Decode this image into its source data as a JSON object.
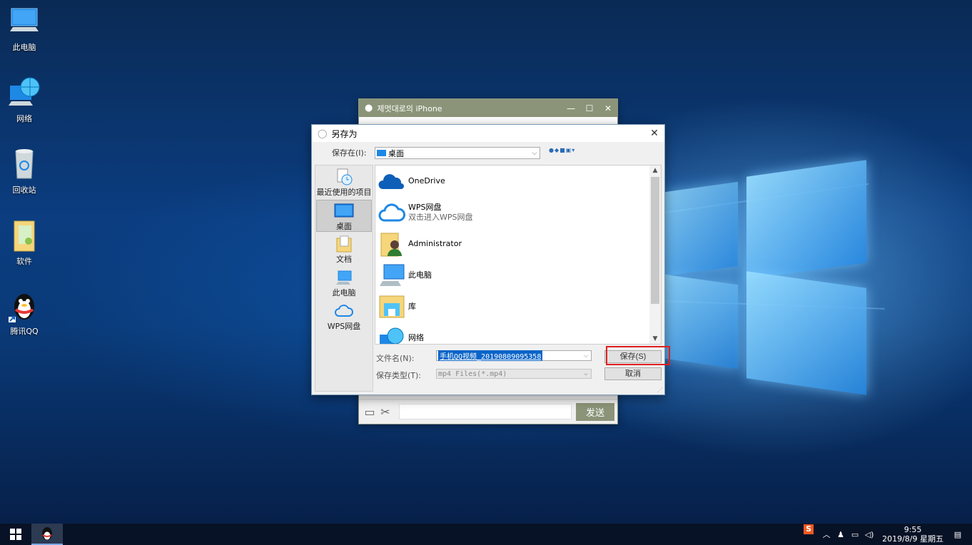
{
  "desktop": {
    "icons": [
      {
        "label": "此电脑",
        "icon": "computer-icon"
      },
      {
        "label": "网络",
        "icon": "network-globe-icon"
      },
      {
        "label": "回收站",
        "icon": "recycle-bin-icon"
      },
      {
        "label": "软件",
        "icon": "folder-icon"
      },
      {
        "label": "腾讯QQ",
        "icon": "qq-penguin-icon"
      }
    ]
  },
  "qq_window": {
    "title": "제멋대로의 iPhone",
    "controls": {
      "minimize": "—",
      "maximize": "☐",
      "close": "✕"
    },
    "send_label": "发送",
    "input_value": ""
  },
  "save_dialog": {
    "title": "另存为",
    "save_in_label": "保存在(I):",
    "save_in_value": "桌面",
    "places": [
      {
        "label": "最近使用的项目",
        "icon": "recent-clock-icon"
      },
      {
        "label": "桌面",
        "icon": "desktop-icon"
      },
      {
        "label": "文档",
        "icon": "documents-icon"
      },
      {
        "label": "此电脑",
        "icon": "computer-icon"
      },
      {
        "label": "WPS网盘",
        "icon": "cloud-icon"
      }
    ],
    "files": [
      {
        "name": "OneDrive",
        "sub": "",
        "icon": "onedrive-cloud-icon"
      },
      {
        "name": "WPS网盘",
        "sub": "双击进入WPS网盘",
        "icon": "wps-cloud-icon"
      },
      {
        "name": "Administrator",
        "sub": "",
        "icon": "user-folder-icon"
      },
      {
        "name": "此电脑",
        "sub": "",
        "icon": "computer-icon"
      },
      {
        "name": "库",
        "sub": "",
        "icon": "library-folder-icon"
      },
      {
        "name": "网络",
        "sub": "",
        "icon": "network-globe-icon"
      }
    ],
    "filename_label": "文件名(N):",
    "filename_value": "手机QQ视频_20190809095358",
    "filetype_label": "保存类型(T):",
    "filetype_value": "mp4 Files(*.mp4)",
    "save_button": "保存(S)",
    "cancel_button": "取消",
    "highlight_color": "#e0201f"
  },
  "taskbar": {
    "time": "9:55",
    "date": "2019/8/9 星期五",
    "tray_icons": [
      "sogou-ime-icon",
      "chevron-up-icon",
      "qq-tray-icon",
      "network-icon",
      "volume-icon",
      "notification-icon"
    ]
  }
}
